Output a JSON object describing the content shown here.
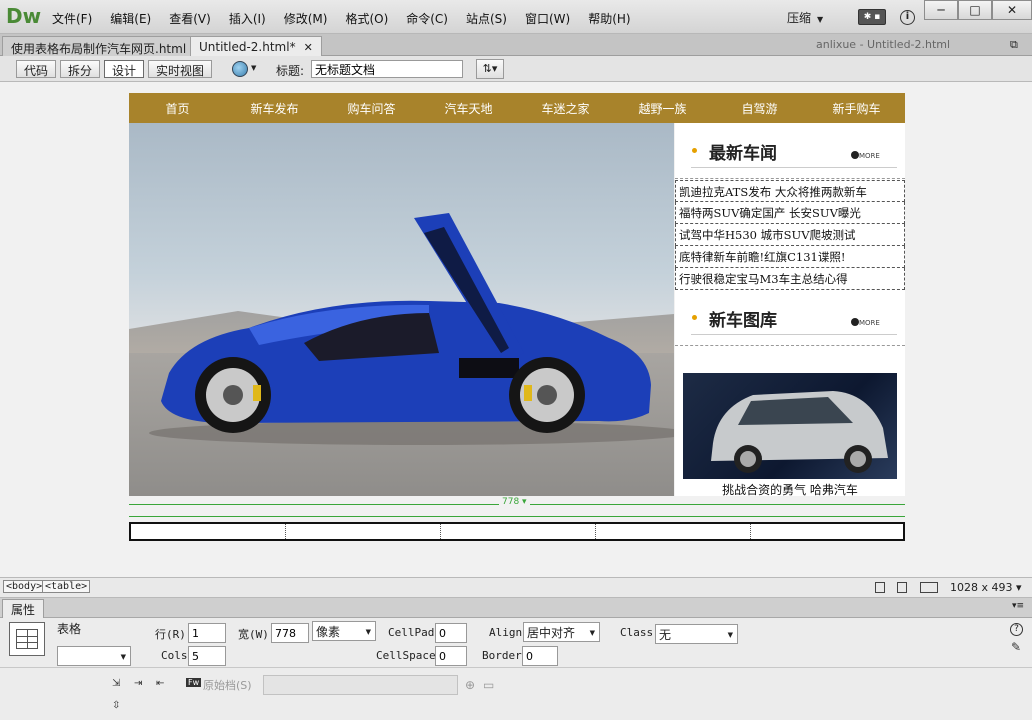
{
  "app": {
    "logo": "Dw",
    "menu": [
      "文件(F)",
      "编辑(E)",
      "查看(V)",
      "插入(I)",
      "修改(M)",
      "格式(O)",
      "命令(C)",
      "站点(S)",
      "窗口(W)",
      "帮助(H)"
    ],
    "workspace": "压缩",
    "window_controls": [
      "─",
      "□",
      "✕"
    ]
  },
  "tabs": [
    {
      "label": "使用表格布局制作汽车网页.html"
    },
    {
      "label": "Untitled-2.html*"
    }
  ],
  "doc_path": "anlixue - Untitled-2.html",
  "toolbar": {
    "views": [
      "代码",
      "拆分",
      "设计",
      "实时视图"
    ],
    "title_label": "标题:",
    "title_value": "无标题文档"
  },
  "page": {
    "nav": [
      "首页",
      "新车发布",
      "购车问答",
      "汽车天地",
      "车迷之家",
      "越野一族",
      "自驾游",
      "新手购车"
    ],
    "news_title": "最新车闻",
    "more": "MORE",
    "news": [
      "凯迪拉克ATS发布 大众将推两款新车",
      "福特两SUV确定国产 长安SUV曝光",
      "试驾中华H530 城市SUV爬坡测试",
      "底特律新车前瞻!红旗C131谍照!",
      "行驶很稳定宝马M3车主总结心得"
    ],
    "gallery_title": "新车图库",
    "gallery_caption": "挑战合资的勇气 哈弗汽车",
    "width_label": "778 ▾"
  },
  "status": {
    "tags": [
      "<body>",
      "<table>"
    ],
    "size": "1028 x 493 ▾"
  },
  "props": {
    "panel_tab": "属性",
    "kind": "表格",
    "rows_label": "行(R)",
    "rows": "1",
    "cols_label": "Cols",
    "cols": "5",
    "width_label": "宽(W)",
    "width": "778",
    "unit": "像素",
    "cellpad_label": "CellPad",
    "cellpad": "0",
    "cellspace_label": "CellSpace",
    "cellspace": "0",
    "align_label": "Align",
    "align": "居中对齐",
    "border_label": "Border",
    "border": "0",
    "class_label": "Class",
    "class": "无",
    "src_label": "原始档(S)"
  }
}
